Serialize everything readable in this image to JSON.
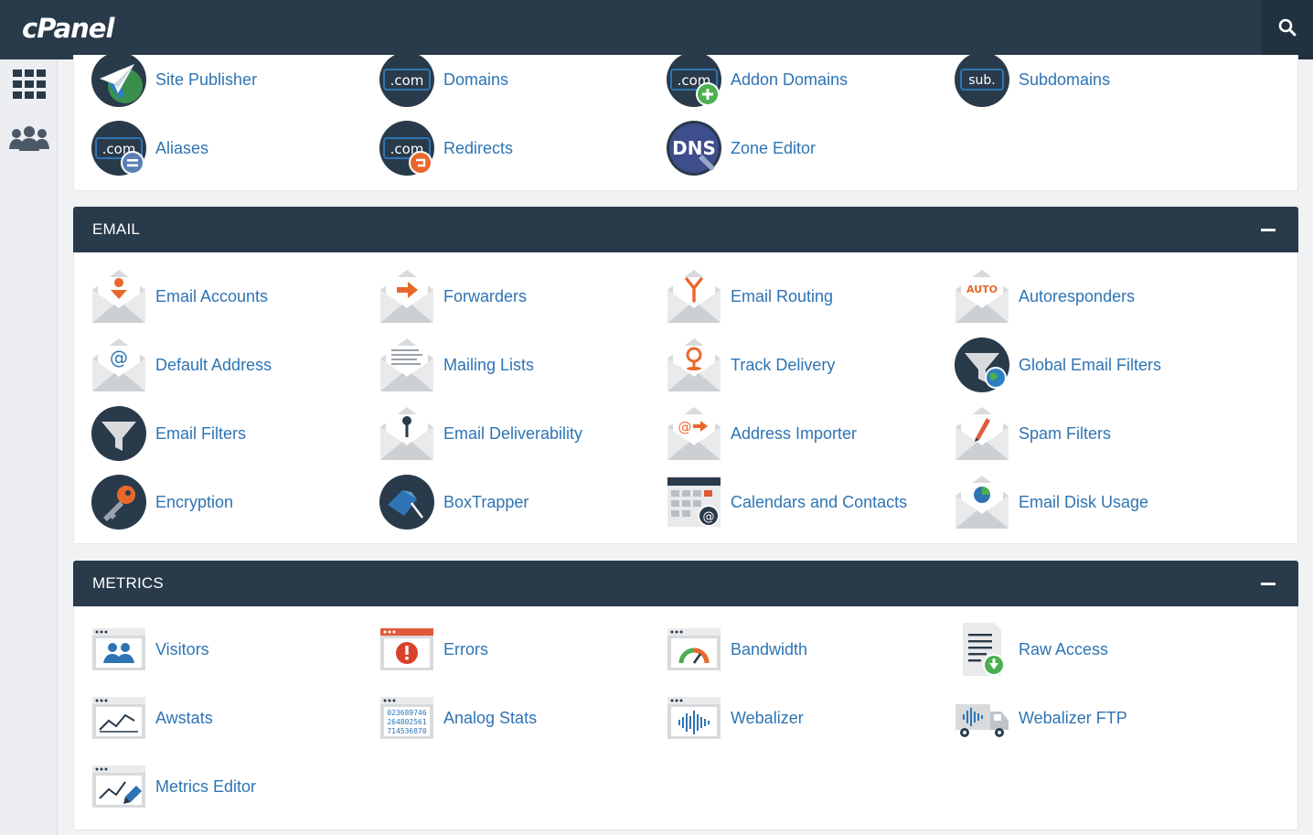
{
  "header": {
    "logo_text": "cPanel",
    "search_icon": "search-icon"
  },
  "sidebar": {
    "items": [
      {
        "icon": "grid-icon"
      },
      {
        "icon": "users-icon"
      }
    ]
  },
  "colors": {
    "navy": "#293a4a",
    "link": "#2e74b4",
    "orange": "#e8682b",
    "green": "#4caf50"
  },
  "domains": {
    "items": [
      {
        "label": "Site Publisher",
        "icon": "site-publisher-icon"
      },
      {
        "label": "Domains",
        "icon": "domains-icon"
      },
      {
        "label": "Addon Domains",
        "icon": "addon-domains-icon"
      },
      {
        "label": "Subdomains",
        "icon": "subdomains-icon"
      },
      {
        "label": "Aliases",
        "icon": "aliases-icon"
      },
      {
        "label": "Redirects",
        "icon": "redirects-icon"
      },
      {
        "label": "Zone Editor",
        "icon": "zone-editor-icon"
      }
    ]
  },
  "email": {
    "title": "EMAIL",
    "items": [
      {
        "label": "Email Accounts",
        "icon": "email-accounts-icon"
      },
      {
        "label": "Forwarders",
        "icon": "forwarders-icon"
      },
      {
        "label": "Email Routing",
        "icon": "email-routing-icon"
      },
      {
        "label": "Autoresponders",
        "icon": "autoresponders-icon"
      },
      {
        "label": "Default Address",
        "icon": "default-address-icon"
      },
      {
        "label": "Mailing Lists",
        "icon": "mailing-lists-icon"
      },
      {
        "label": "Track Delivery",
        "icon": "track-delivery-icon"
      },
      {
        "label": "Global Email Filters",
        "icon": "global-email-filters-icon"
      },
      {
        "label": "Email Filters",
        "icon": "email-filters-icon"
      },
      {
        "label": "Email Deliverability",
        "icon": "email-deliverability-icon"
      },
      {
        "label": "Address Importer",
        "icon": "address-importer-icon"
      },
      {
        "label": "Spam Filters",
        "icon": "spam-filters-icon"
      },
      {
        "label": "Encryption",
        "icon": "encryption-icon"
      },
      {
        "label": "BoxTrapper",
        "icon": "boxtrapper-icon"
      },
      {
        "label": "Calendars and Contacts",
        "icon": "calendars-contacts-icon"
      },
      {
        "label": "Email Disk Usage",
        "icon": "email-disk-usage-icon"
      }
    ]
  },
  "metrics": {
    "title": "METRICS",
    "items": [
      {
        "label": "Visitors",
        "icon": "visitors-icon"
      },
      {
        "label": "Errors",
        "icon": "errors-icon"
      },
      {
        "label": "Bandwidth",
        "icon": "bandwidth-icon"
      },
      {
        "label": "Raw Access",
        "icon": "raw-access-icon"
      },
      {
        "label": "Awstats",
        "icon": "awstats-icon"
      },
      {
        "label": "Analog Stats",
        "icon": "analog-stats-icon"
      },
      {
        "label": "Webalizer",
        "icon": "webalizer-icon"
      },
      {
        "label": "Webalizer FTP",
        "icon": "webalizer-ftp-icon"
      },
      {
        "label": "Metrics Editor",
        "icon": "metrics-editor-icon"
      }
    ]
  },
  "icon_text": {
    "com": ".com",
    "sub": "sub.",
    "dns": "DNS",
    "auto": "AUTO",
    "at": "@",
    "analog_digits": [
      "023689746",
      "264802561",
      "714536870"
    ]
  }
}
